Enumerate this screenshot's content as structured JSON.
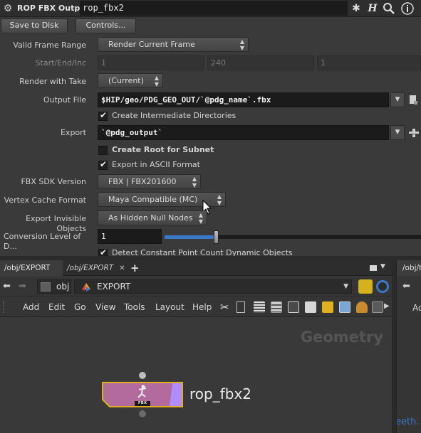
{
  "header": {
    "node_type": "ROP FBX Output",
    "node_name": "rop_fbx2",
    "icons": [
      "gear-icon",
      "houdini-h-icon",
      "search-icon",
      "info-icon"
    ]
  },
  "buttons": {
    "save_to_disk": "Save to Disk",
    "controls": "Controls..."
  },
  "params": {
    "valid_frame_range": {
      "label": "Valid Frame Range",
      "value": "Render Current Frame"
    },
    "start_end_inc": {
      "label": "Start/End/Inc",
      "values": [
        "1",
        "240",
        "1"
      ]
    },
    "render_with_take": {
      "label": "Render with Take",
      "value": "(Current)"
    },
    "output_file": {
      "label": "Output File",
      "value": "$HIP/geo/PDG_GEO_OUT/`@pdg_name`.fbx"
    },
    "create_intermediate_dirs": {
      "label": "Create Intermediate Directories",
      "checked": true
    },
    "export": {
      "label": "Export",
      "value": "`@pdg_output`"
    },
    "create_root_for_subnet": {
      "label": "Create Root for Subnet",
      "checked": false
    },
    "export_ascii": {
      "label": "Export in ASCII Format",
      "checked": true
    },
    "fbx_sdk_version": {
      "label": "FBX SDK Version",
      "value": "FBX | FBX201600"
    },
    "vertex_cache_format": {
      "label": "Vertex Cache Format",
      "value": "Maya Compatible (MC)"
    },
    "export_invisible_objects": {
      "label": "Export Invisible Objects",
      "value": "As Hidden Null Nodes"
    },
    "conversion_level": {
      "label": "Conversion Level of D...",
      "value": "1"
    },
    "detect_constant": {
      "label": "Detect Constant Point Count Dynamic Objects",
      "checked": true
    }
  },
  "network": {
    "tabs": [
      {
        "label": "/obj/EXPORT",
        "active": true
      },
      {
        "label": "/obj/EXPORT",
        "active": false
      }
    ],
    "right_tab": "/obj/t",
    "path": {
      "root": "obj",
      "current": "EXPORT"
    },
    "menu": [
      "Add",
      "Edit",
      "Go",
      "View",
      "Tools",
      "Layout",
      "Help"
    ],
    "right_menu": "Ad",
    "context_label": "Geometry",
    "node": {
      "name": "rop_fbx2",
      "badge": "FBX"
    },
    "right_snippet": "eeth."
  },
  "colors": {
    "node_fill": "#b36b9e",
    "node_border": "#e0b020",
    "node_flag": "#b08cff",
    "accent_blue": "#3a78c9"
  }
}
